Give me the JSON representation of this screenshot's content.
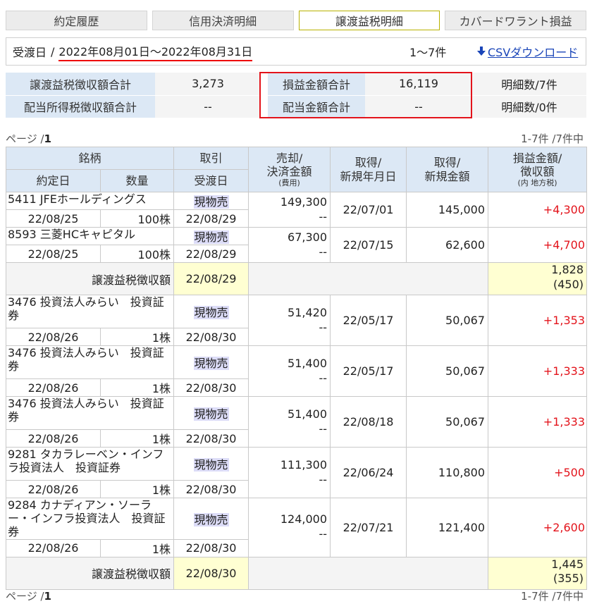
{
  "tabs": [
    "約定履歴",
    "信用決済明細",
    "譲渡益税明細",
    "カバードワラント損益"
  ],
  "date_bar": {
    "label": "受渡日",
    "sep": "/",
    "range": "2022年08月01日〜2022年08月31日",
    "count": "1〜7件",
    "csv": "CSVダウンロード"
  },
  "summary": {
    "tax_total_label": "譲渡益税徴収額合計",
    "tax_total": "3,273",
    "pl_total_label": "損益金額合計",
    "pl_total": "16,119",
    "detail_count_1": "明細数/7件",
    "div_tax_label": "配当所得税徴収額合計",
    "div_tax": "--",
    "div_total_label": "配当金額合計",
    "div_total": "--",
    "detail_count_2": "明細数/0件"
  },
  "pager": {
    "page_label": "ページ /",
    "page": "1",
    "range": "1-7件 /7件中"
  },
  "headers": {
    "brand": "銘柄",
    "trade": "取引",
    "sell": "売却/",
    "sell2": "決済金額",
    "sell_sub": "(費用)",
    "acq_date": "取得/",
    "acq_date2": "新規年月日",
    "acq_amt": "取得/",
    "acq_amt2": "新規金額",
    "pl": "損益金額/",
    "pl2": "徴収額",
    "pl_sub": "(内 地方税)",
    "trade_date": "約定日",
    "qty": "数量",
    "settle_date": "受渡日"
  },
  "rows": [
    {
      "brand": "5411 JFEホールディングス",
      "type": "現物売",
      "sell": "149,300",
      "fee": "--",
      "acq_date": "22/07/01",
      "acq_amt": "145,000",
      "pl": "+4,300",
      "trade_date": "22/08/25",
      "qty": "100株",
      "settle": "22/08/29"
    },
    {
      "brand": "8593 三菱HCキャピタル",
      "type": "現物売",
      "sell": "67,300",
      "fee": "--",
      "acq_date": "22/07/15",
      "acq_amt": "62,600",
      "pl": "+4,700",
      "trade_date": "22/08/25",
      "qty": "100株",
      "settle": "22/08/29"
    },
    {
      "brand": "3476 投資法人みらい　投資証券",
      "type": "現物売",
      "sell": "51,420",
      "fee": "--",
      "acq_date": "22/05/17",
      "acq_amt": "50,067",
      "pl": "+1,353",
      "trade_date": "22/08/26",
      "qty": "1株",
      "settle": "22/08/30"
    },
    {
      "brand": "3476 投資法人みらい　投資証券",
      "type": "現物売",
      "sell": "51,400",
      "fee": "--",
      "acq_date": "22/05/17",
      "acq_amt": "50,067",
      "pl": "+1,333",
      "trade_date": "22/08/26",
      "qty": "1株",
      "settle": "22/08/30"
    },
    {
      "brand": "3476 投資法人みらい　投資証券",
      "type": "現物売",
      "sell": "51,400",
      "fee": "--",
      "acq_date": "22/08/18",
      "acq_amt": "50,067",
      "pl": "+1,333",
      "trade_date": "22/08/26",
      "qty": "1株",
      "settle": "22/08/30"
    },
    {
      "brand": "9281 タカラレーベン・インフラ投資法人　投資証券",
      "type": "現物売",
      "sell": "111,300",
      "fee": "--",
      "acq_date": "22/06/24",
      "acq_amt": "110,800",
      "pl": "+500",
      "trade_date": "22/08/26",
      "qty": "1株",
      "settle": "22/08/30"
    },
    {
      "brand": "9284 カナディアン・ソーラー・インフラ投資法人　投資証券",
      "type": "現物売",
      "sell": "124,000",
      "fee": "--",
      "acq_date": "22/07/21",
      "acq_amt": "121,400",
      "pl": "+2,600",
      "trade_date": "22/08/26",
      "qty": "1株",
      "settle": "22/08/30"
    }
  ],
  "subtotals": [
    {
      "label": "譲渡益税徴収額",
      "date": "22/08/29",
      "amount": "1,828",
      "local": "(450)"
    },
    {
      "label": "譲渡益税徴収額",
      "date": "22/08/30",
      "amount": "1,445",
      "local": "(355)"
    }
  ]
}
